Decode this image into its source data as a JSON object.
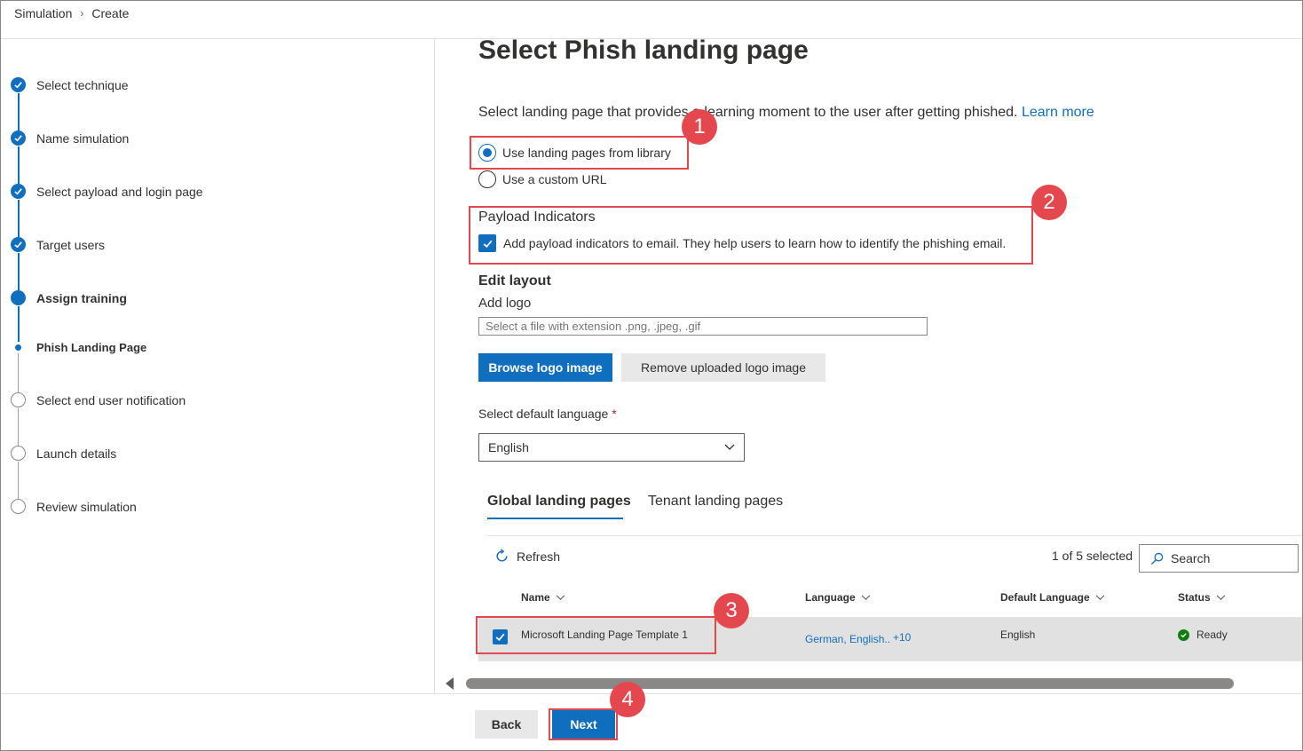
{
  "breadcrumb": {
    "root": "Simulation",
    "separator": ">",
    "current": "Create"
  },
  "steps": [
    {
      "label": "Select technique",
      "state": "done"
    },
    {
      "label": "Name simulation",
      "state": "done"
    },
    {
      "label": "Select payload and login page",
      "state": "done"
    },
    {
      "label": "Target users",
      "state": "done"
    },
    {
      "label": "Assign training",
      "state": "current"
    },
    {
      "label": "Phish Landing Page",
      "state": "current-sub"
    },
    {
      "label": "Select end user notification",
      "state": "todo"
    },
    {
      "label": "Launch details",
      "state": "todo"
    },
    {
      "label": "Review simulation",
      "state": "todo"
    }
  ],
  "page": {
    "title": "Select Phish landing page",
    "description": "Select landing page that provides a learning moment to the user after getting phished.",
    "learn_more": "Learn more"
  },
  "source_options": {
    "library": "Use landing pages from library",
    "custom_url": "Use a custom URL",
    "selected": "library"
  },
  "payload_indicators": {
    "heading": "Payload Indicators",
    "checkbox_label": "Add payload indicators to email. They help users to learn how to identify the phishing email.",
    "checked": true
  },
  "edit_layout": {
    "heading": "Edit layout",
    "add_logo_label": "Add logo",
    "file_placeholder": "Select a file with extension .png, .jpeg, .gif",
    "browse_button": "Browse logo image",
    "remove_button": "Remove uploaded logo image"
  },
  "language": {
    "label": "Select default language",
    "required_mark": "*",
    "value": "English"
  },
  "tabs": [
    {
      "label": "Global landing pages",
      "active": true
    },
    {
      "label": "Tenant landing pages",
      "active": false
    }
  ],
  "toolbar": {
    "refresh": "Refresh",
    "selected_count": "1 of 5 selected",
    "search": "Search"
  },
  "table": {
    "columns": [
      "Name",
      "Language",
      "Default Language",
      "Status"
    ],
    "rows": [
      {
        "name": "Microsoft Landing Page Template 1",
        "language": "German, English..",
        "language_more": "+10",
        "default_language": "English",
        "status": "Ready",
        "selected": true
      }
    ]
  },
  "footer": {
    "back": "Back",
    "next": "Next"
  },
  "annotations": [
    "1",
    "2",
    "3",
    "4"
  ],
  "colors": {
    "accent": "#106ebe",
    "annotation": "#e5474f",
    "status_ready": "#107c10"
  }
}
